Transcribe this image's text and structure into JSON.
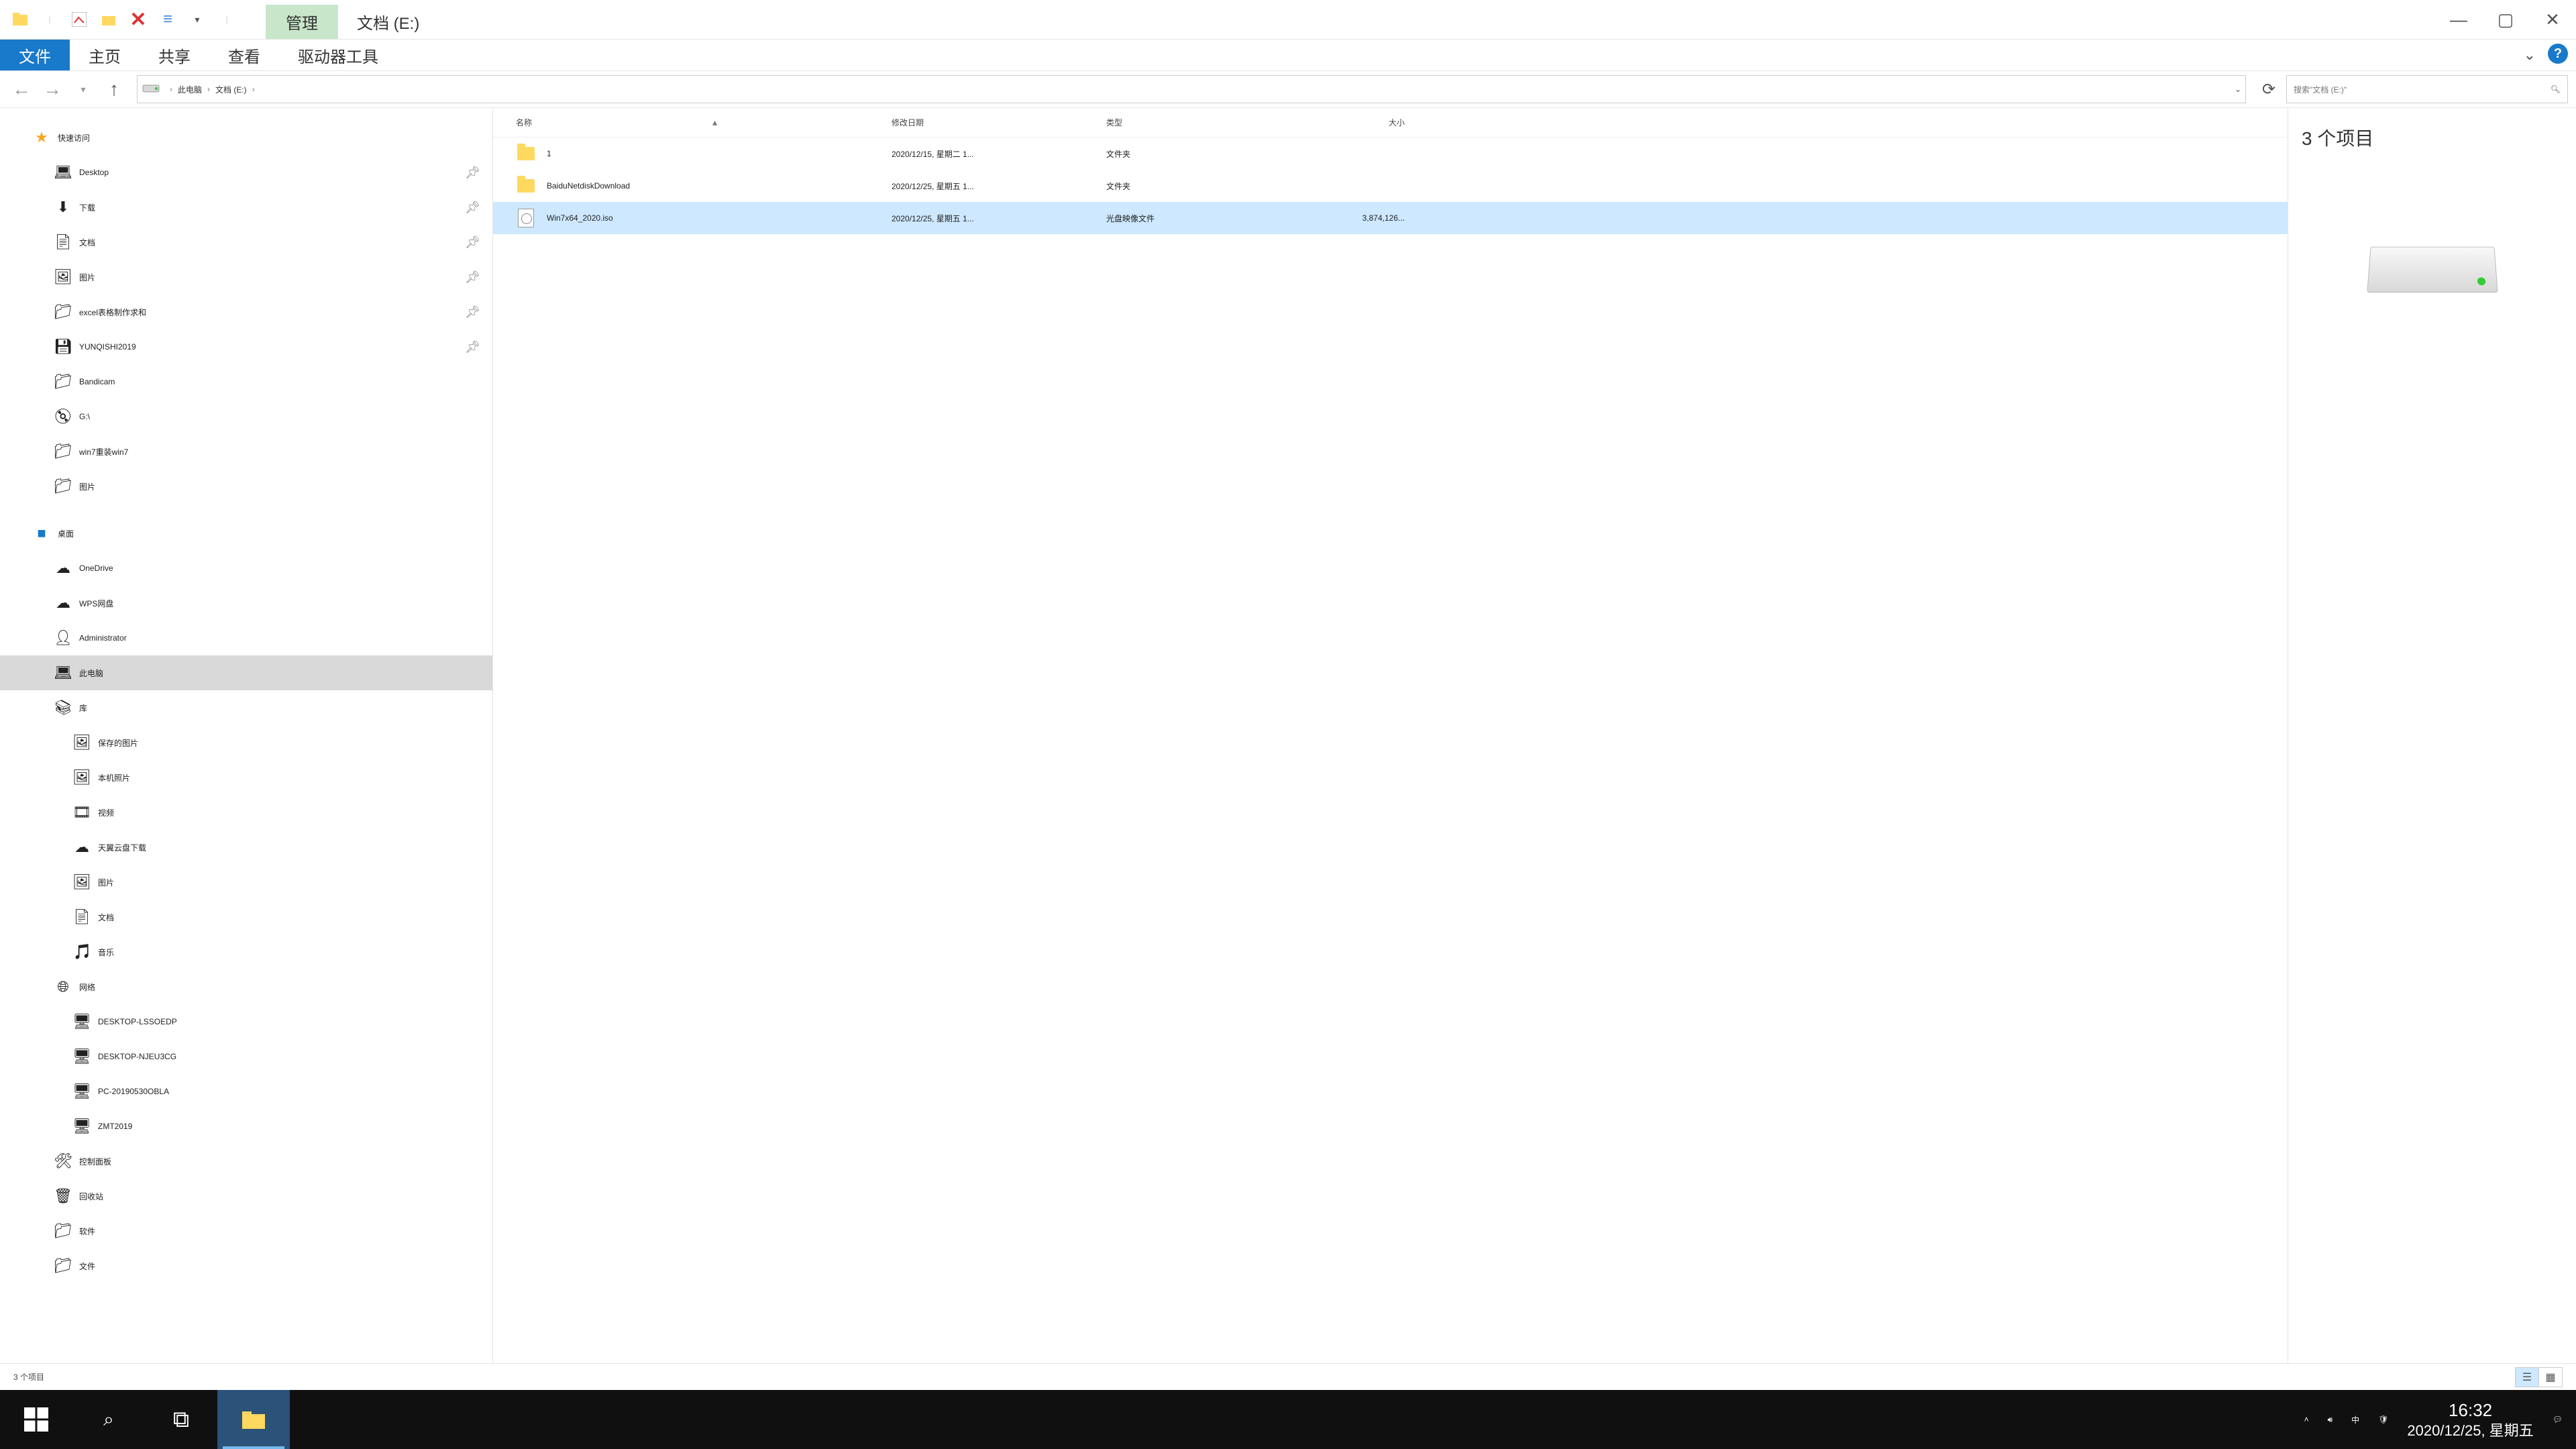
{
  "title": {
    "context_tab": "管理",
    "location": "文档 (E:)"
  },
  "ribbon": {
    "file": "文件",
    "home": "主页",
    "share": "共享",
    "view": "查看",
    "drive_tools": "驱动器工具"
  },
  "nav": {
    "breadcrumb": [
      "此电脑",
      "文档 (E:)"
    ],
    "search_placeholder": "搜索\"文档 (E:)\""
  },
  "columns": {
    "name": "名称",
    "date": "修改日期",
    "type": "类型",
    "size": "大小"
  },
  "files": [
    {
      "name": "1",
      "date": "2020/12/15, 星期二 1...",
      "type": "文件夹",
      "size": "",
      "icon": "folder",
      "selected": false
    },
    {
      "name": "BaiduNetdiskDownload",
      "date": "2020/12/25, 星期五 1...",
      "type": "文件夹",
      "size": "",
      "icon": "folder",
      "selected": false
    },
    {
      "name": "Win7x64_2020.iso",
      "date": "2020/12/25, 星期五 1...",
      "type": "光盘映像文件",
      "size": "3,874,126...",
      "icon": "iso",
      "selected": true
    }
  ],
  "preview": {
    "count": "3 个项目"
  },
  "tree": {
    "quick_access": "快速访问",
    "qa": [
      {
        "label": "Desktop",
        "icon": "💻",
        "pin": true
      },
      {
        "label": "下载",
        "icon": "⬇",
        "pin": true
      },
      {
        "label": "文档",
        "icon": "📄",
        "pin": true
      },
      {
        "label": "图片",
        "icon": "🖼",
        "pin": true
      },
      {
        "label": "excel表格制作求和",
        "icon": "📁",
        "pin": true
      },
      {
        "label": "YUNQISHI2019",
        "icon": "💾",
        "pin": true
      },
      {
        "label": "Bandicam",
        "icon": "📁",
        "pin": false
      },
      {
        "label": "G:\\",
        "icon": "💿",
        "pin": false
      },
      {
        "label": "win7重装win7",
        "icon": "📁",
        "pin": false
      },
      {
        "label": "图片",
        "icon": "📁",
        "pin": false
      }
    ],
    "desktop": "桌面",
    "desk": [
      {
        "label": "OneDrive",
        "icon": "☁"
      },
      {
        "label": "WPS网盘",
        "icon": "☁"
      },
      {
        "label": "Administrator",
        "icon": "👤"
      },
      {
        "label": "此电脑",
        "icon": "💻",
        "selected": true
      },
      {
        "label": "库",
        "icon": "📚"
      }
    ],
    "libs": [
      {
        "label": "保存的图片",
        "icon": "🖼"
      },
      {
        "label": "本机照片",
        "icon": "🖼"
      },
      {
        "label": "视频",
        "icon": "🎞"
      },
      {
        "label": "天翼云盘下载",
        "icon": "☁"
      },
      {
        "label": "图片",
        "icon": "🖼"
      },
      {
        "label": "文档",
        "icon": "📄"
      },
      {
        "label": "音乐",
        "icon": "🎵"
      }
    ],
    "network": "网络",
    "net": [
      {
        "label": "DESKTOP-LSSOEDP",
        "icon": "🖥"
      },
      {
        "label": "DESKTOP-NJEU3CG",
        "icon": "🖥"
      },
      {
        "label": "PC-20190530OBLA",
        "icon": "🖥"
      },
      {
        "label": "ZMT2019",
        "icon": "🖥"
      }
    ],
    "control_panel": "控制面板",
    "recycle": "回收站",
    "software": "软件",
    "files_folder": "文件"
  },
  "status": {
    "text": "3 个项目"
  },
  "taskbar": {
    "time": "16:32",
    "date": "2020/12/25, 星期五",
    "ime": "中"
  }
}
